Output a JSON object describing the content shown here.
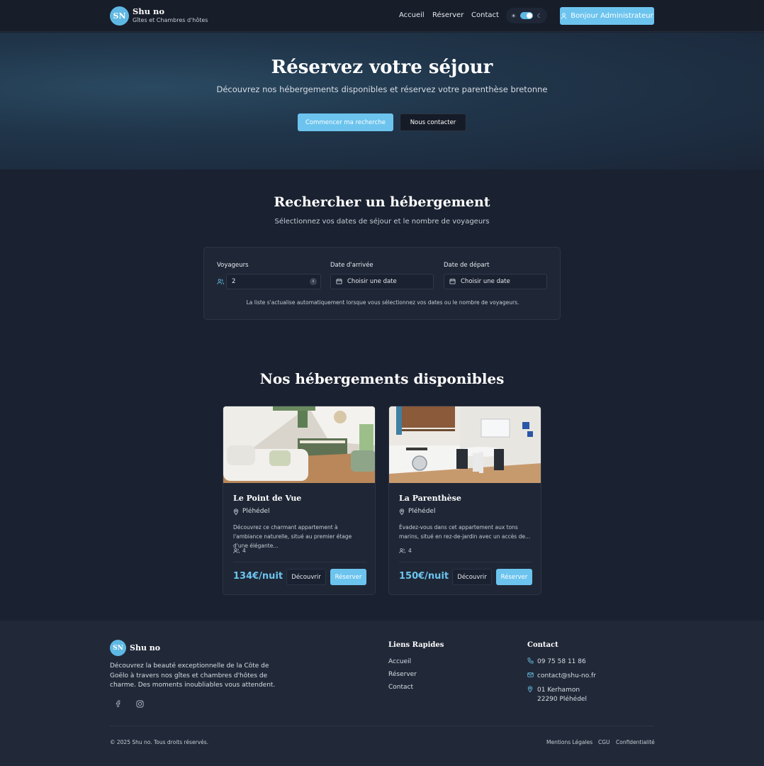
{
  "header": {
    "logo_initials": "SN",
    "logo_name": "Shu no",
    "logo_sub": "Gîtes et Chambres d'hôtes",
    "nav": [
      "Accueil",
      "Réserver",
      "Contact"
    ],
    "admin_button": "Bonjour Administrateur"
  },
  "hero": {
    "title": "Réservez votre séjour",
    "subtitle": "Découvrez nos hébergements disponibles et réservez votre parenthèse bretonne",
    "primary_button": "Commencer ma recherche",
    "secondary_button": "Nous contacter"
  },
  "search": {
    "title": "Rechercher un hébergement",
    "subtitle": "Sélectionnez vos dates de séjour et le nombre de voyageurs",
    "travelers_label": "Voyageurs",
    "travelers_value": "2",
    "arrival_label": "Date d'arrivée",
    "arrival_placeholder": "Choisir une date",
    "departure_label": "Date de départ",
    "departure_placeholder": "Choisir une date",
    "note": "La liste s'actualise automatiquement lorsque vous sélectionnez vos dates ou le nombre de voyageurs."
  },
  "listings": {
    "title": "Nos hébergements disponibles",
    "items": [
      {
        "name": "Le Point de Vue",
        "location": "Pléhédel",
        "description": "Découvrez ce charmant appartement à l'ambiance naturelle, situé au premier étage d'une élégante...",
        "capacity": "4",
        "price": "134€/nuit",
        "discover": "Découvrir",
        "book": "Réserver"
      },
      {
        "name": "La Parenthèse",
        "location": "Pléhédel",
        "description": "Évadez-vous dans cet appartement aux tons marins, situé en rez-de-jardin avec un accès de...",
        "capacity": "4",
        "price": "150€/nuit",
        "discover": "Découvrir",
        "book": "Réserver"
      }
    ]
  },
  "footer": {
    "logo_initials": "SN",
    "logo_name": "Shu no",
    "description": "Découvrez la beauté exceptionnelle de la Côte de Goëlo à travers nos gîtes et chambres d'hôtes de charme. Des moments inoubliables vous attendent.",
    "links_title": "Liens Rapides",
    "links": [
      "Accueil",
      "Réserver",
      "Contact"
    ],
    "contact_title": "Contact",
    "phone": "09 75 58 11 86",
    "email": "contact@shu-no.fr",
    "address_line1": "01 Kerhamon",
    "address_line2": "22290 Pléhédel",
    "copyright": "© 2025 Shu no. Tous droits réservés.",
    "legal": [
      "Mentions Légales",
      "CGU",
      "Confidentialité"
    ]
  },
  "colors": {
    "accent": "#6cc4ee",
    "background": "#1a2130",
    "card": "#1f2736"
  }
}
